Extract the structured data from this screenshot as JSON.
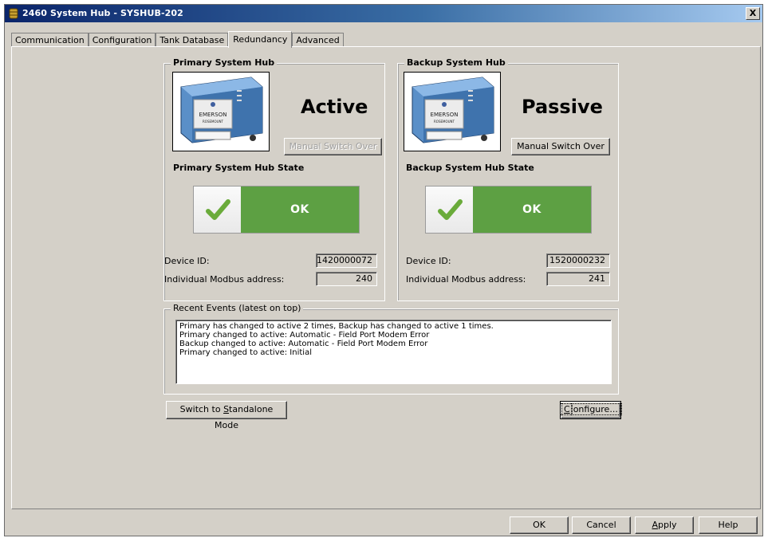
{
  "window": {
    "title": "2460 System Hub  - SYSHUB-202",
    "close_label": "X"
  },
  "tabs": [
    {
      "label": "Communication"
    },
    {
      "label": "Configuration"
    },
    {
      "label": "Tank Database"
    },
    {
      "label": "Redundancy"
    },
    {
      "label": "Advanced"
    }
  ],
  "active_tab": "Redundancy",
  "primary": {
    "group_title": "Primary System Hub",
    "status": "Active",
    "switch_button": "Manual Switch Over",
    "switch_enabled": false,
    "state_label": "Primary System Hub State",
    "state_value": "OK",
    "device_id_label": "Device ID:",
    "device_id": "1420000072",
    "modbus_label": "Individual Modbus address:",
    "modbus_address": "240"
  },
  "backup": {
    "group_title": "Backup System Hub",
    "status": "Passive",
    "switch_button": "Manual Switch Over",
    "switch_enabled": true,
    "state_label": "Backup System Hub State",
    "state_value": "OK",
    "device_id_label": "Device ID:",
    "device_id": "1520000232",
    "modbus_label": "Individual Modbus address:",
    "modbus_address": "241"
  },
  "device_image": {
    "brand": "EMERSON",
    "sub_brand": "ROSEMOUNT"
  },
  "events": {
    "title": "Recent Events (latest on top)",
    "lines": [
      "Primary has changed to active 2 times, Backup has changed to active 1 times.",
      "Primary changed to active: Automatic - Field Port Modem Error",
      "Backup changed to active: Automatic - Field Port Modem Error",
      "Primary changed to active: Initial"
    ]
  },
  "buttons": {
    "standalone_pre": "Switch to ",
    "standalone_u": "S",
    "standalone_post": "tandalone Mode",
    "configure_u": "C",
    "configure_post": "onfigure...",
    "ok": "OK",
    "cancel": "Cancel",
    "apply_u": "A",
    "apply_post": "pply",
    "help": "Help"
  },
  "colors": {
    "ok_green": "#5da043",
    "titlebar_start": "#0a246a",
    "titlebar_end": "#a6caf0"
  }
}
